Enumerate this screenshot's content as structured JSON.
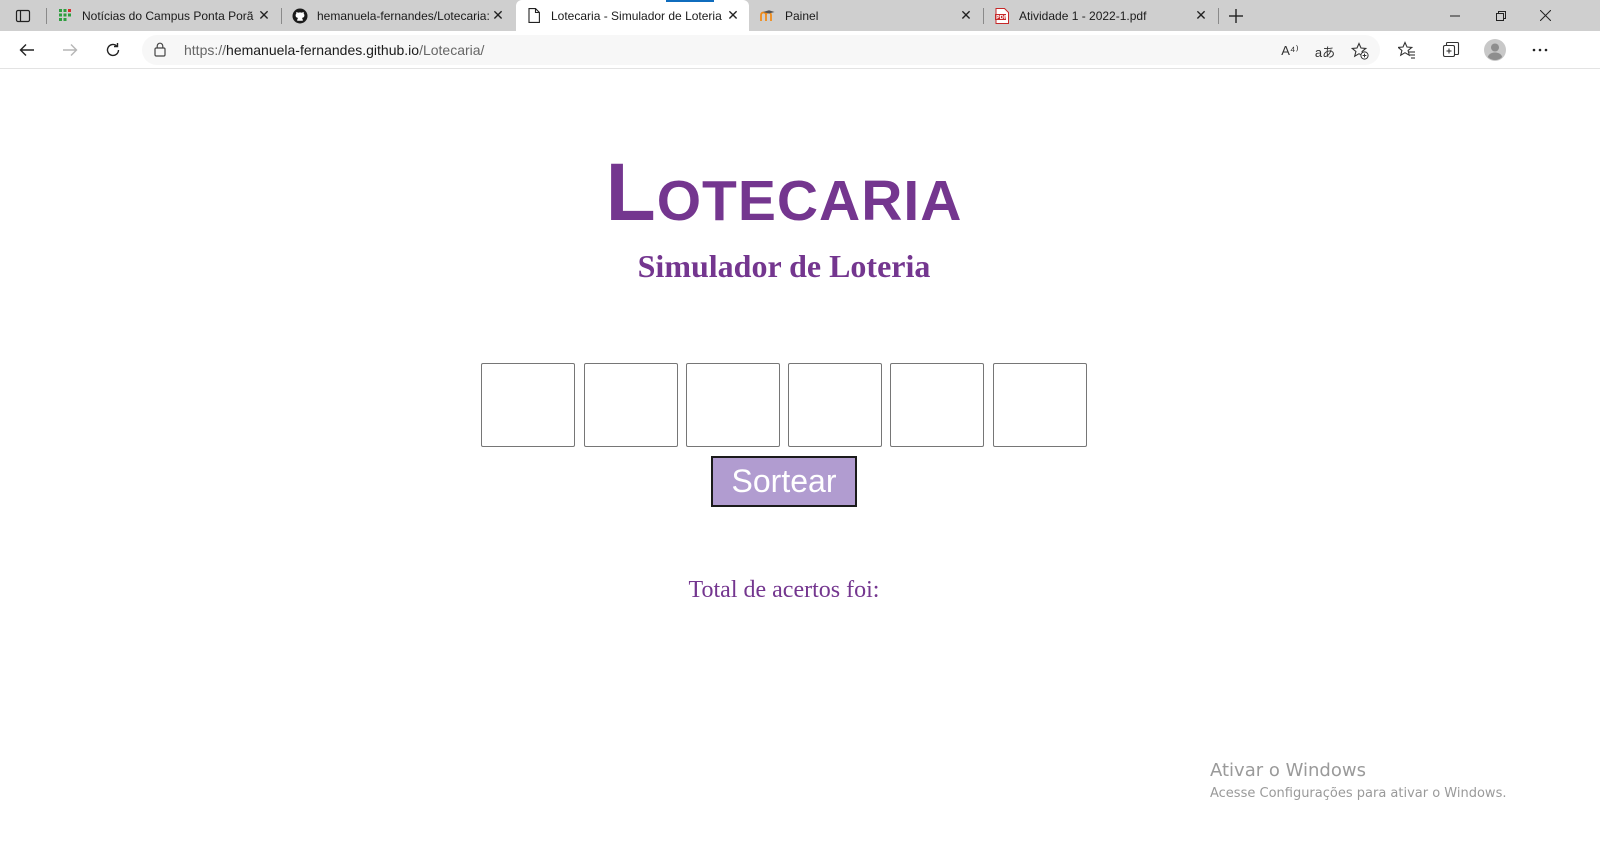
{
  "browser": {
    "tabs": [
      {
        "title": "Notícias do Campus Ponta Porã -",
        "icon": "ifms-grid-icon",
        "active": false
      },
      {
        "title": "hemanuela-fernandes/Lotecaria:",
        "icon": "github-icon",
        "active": false
      },
      {
        "title": "Lotecaria - Simulador de Loteria",
        "icon": "page-icon",
        "active": true
      },
      {
        "title": "Painel",
        "icon": "moodle-icon",
        "active": false
      },
      {
        "title": "Atividade 1 - 2022-1.pdf",
        "icon": "pdf-icon",
        "active": false
      }
    ],
    "url_prefix": "https://",
    "url_host": "hemanuela-fernandes.github.io",
    "url_path": "/Lotecaria/",
    "icons": {
      "read_aloud": "A⁴⁾",
      "translate": "aあ"
    }
  },
  "page": {
    "title": "Lotecaria",
    "subtitle": "Simulador de Loteria",
    "number_inputs": [
      "",
      "",
      "",
      "",
      "",
      ""
    ],
    "draw_button": "Sortear",
    "result_label": "Total de acertos foi:"
  },
  "watermark": {
    "title": "Ativar o Windows",
    "subtitle": "Acesse Configurações para ativar o Windows."
  },
  "colors": {
    "accent": "#74368f",
    "button_bg": "#b19cd0",
    "tabstrip_bg": "#cfcfcf"
  }
}
